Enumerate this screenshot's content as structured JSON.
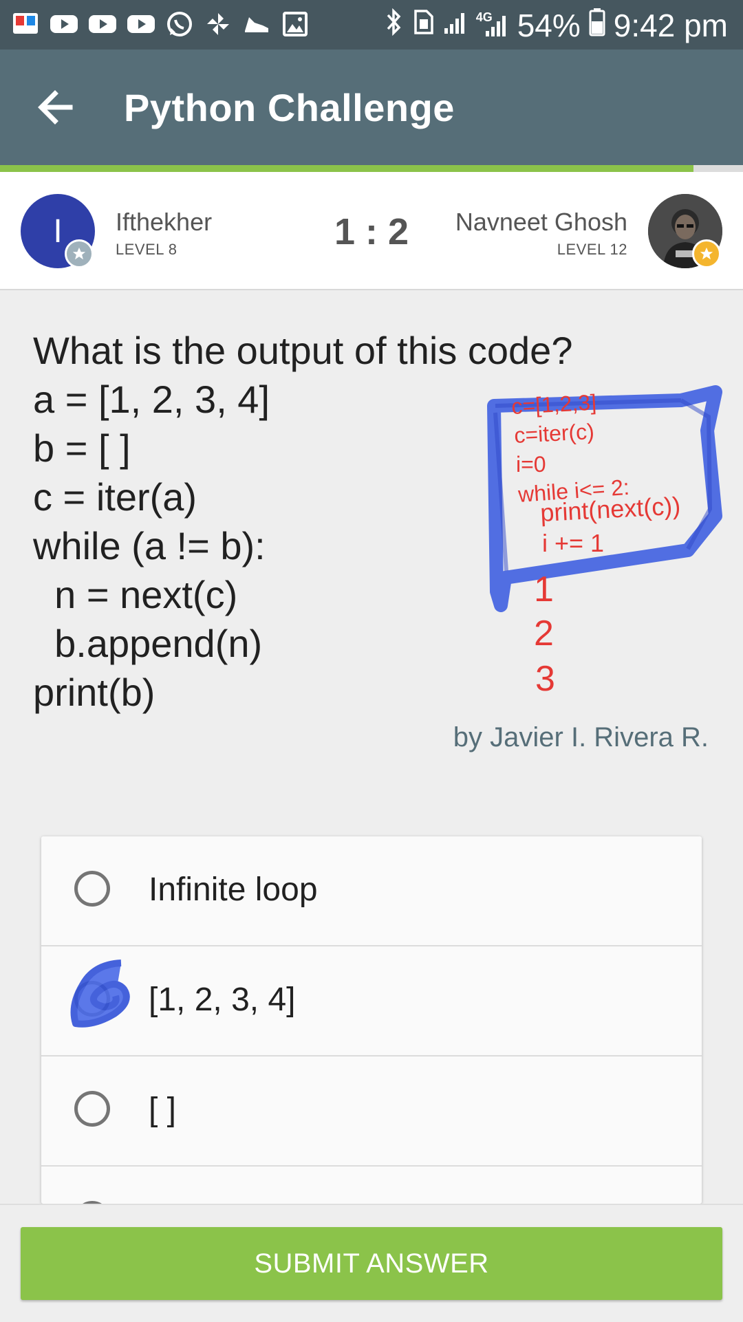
{
  "status_bar": {
    "battery_percent": "54%",
    "time": "9:42 pm",
    "network_label": "4G",
    "left_icons": [
      "dictionary-app-icon",
      "youtube-icon",
      "youtube-icon",
      "youtube-icon",
      "whatsapp-icon",
      "pinwheel-icon",
      "shoe-icon",
      "image-icon"
    ],
    "right_icons": [
      "bluetooth-icon",
      "sim-icon",
      "signal-icon",
      "signal-4g-icon",
      "battery-icon"
    ]
  },
  "app_bar": {
    "title": "Python Challenge"
  },
  "progress": {
    "fraction": 0.933
  },
  "players": {
    "left": {
      "initial": "I",
      "name": "Ifthekher",
      "level": "LEVEL 8"
    },
    "score": "1 : 2",
    "right": {
      "name": "Navneet Ghosh",
      "level": "LEVEL 12"
    }
  },
  "question": {
    "text": "What is the output of this code?\na = [1, 2, 3, 4]\nb = [ ]\nc = iter(a)\nwhile (a != b):\n  n = next(c)\n  b.append(n)\nprint(b)",
    "author": "by Javier I. Rivera R."
  },
  "annotation": {
    "code_lines": [
      "c=[1,2,3]",
      "c=iter(c)",
      "i=0",
      "while i<= 2:",
      "print(next(c))",
      "i += 1"
    ],
    "outputs": [
      "1",
      "2",
      "3"
    ]
  },
  "options": [
    {
      "label": "Infinite loop"
    },
    {
      "label": "[1, 2, 3, 4]"
    },
    {
      "label": "[ ]"
    }
  ],
  "submit_label": "SUBMIT ANSWER",
  "colors": {
    "status_bar": "#46575f",
    "app_bar": "#566e78",
    "accent_green": "#8bc34a",
    "annotation_red": "#e53935",
    "annotation_blue": "#3f5fe0"
  }
}
